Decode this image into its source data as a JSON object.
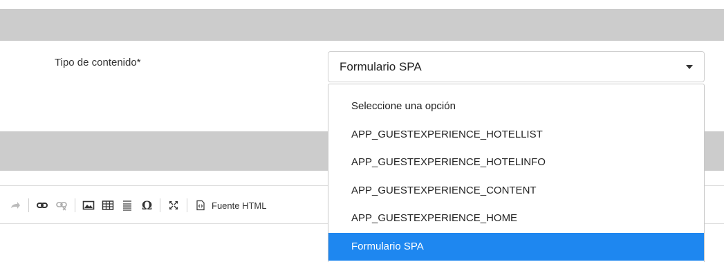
{
  "form": {
    "content_type_label": "Tipo de contenido*",
    "content_type_value": "Formulario SPA"
  },
  "dropdown": {
    "options": [
      "Seleccione una opción",
      "APP_GUESTEXPERIENCE_HOTELLIST",
      "APP_GUESTEXPERIENCE_HOTELINFO",
      "APP_GUESTEXPERIENCE_CONTENT",
      "APP_GUESTEXPERIENCE_HOME",
      "Formulario SPA"
    ],
    "selected_index": 5
  },
  "toolbar": {
    "source_label": "Fuente HTML",
    "icons": [
      "redo-icon",
      "link-icon",
      "unlink-icon",
      "image-icon",
      "table-icon",
      "horizontal-line-icon",
      "special-char-icon",
      "maximize-icon",
      "source-icon"
    ]
  },
  "colors": {
    "band": "#cccccc",
    "selected_option": "#1e87f0"
  }
}
